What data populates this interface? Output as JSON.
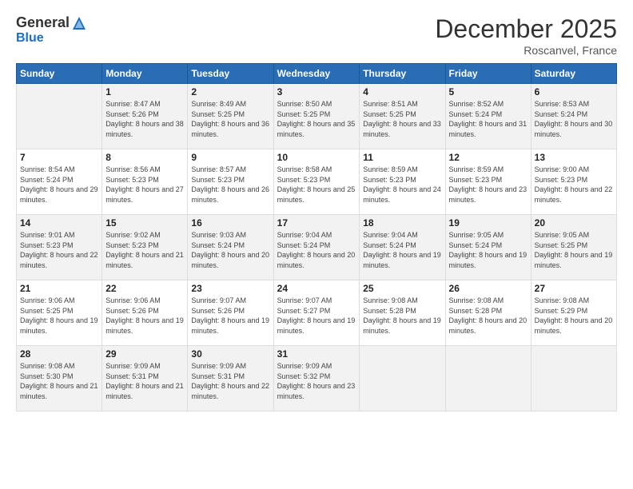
{
  "header": {
    "logo_general": "General",
    "logo_blue": "Blue",
    "month_title": "December 2025",
    "location": "Roscanvel, France"
  },
  "days_of_week": [
    "Sunday",
    "Monday",
    "Tuesday",
    "Wednesday",
    "Thursday",
    "Friday",
    "Saturday"
  ],
  "weeks": [
    [
      {
        "day": "",
        "detail": ""
      },
      {
        "day": "1",
        "detail": "Sunrise: 8:47 AM\nSunset: 5:26 PM\nDaylight: 8 hours\nand 38 minutes."
      },
      {
        "day": "2",
        "detail": "Sunrise: 8:49 AM\nSunset: 5:25 PM\nDaylight: 8 hours\nand 36 minutes."
      },
      {
        "day": "3",
        "detail": "Sunrise: 8:50 AM\nSunset: 5:25 PM\nDaylight: 8 hours\nand 35 minutes."
      },
      {
        "day": "4",
        "detail": "Sunrise: 8:51 AM\nSunset: 5:25 PM\nDaylight: 8 hours\nand 33 minutes."
      },
      {
        "day": "5",
        "detail": "Sunrise: 8:52 AM\nSunset: 5:24 PM\nDaylight: 8 hours\nand 31 minutes."
      },
      {
        "day": "6",
        "detail": "Sunrise: 8:53 AM\nSunset: 5:24 PM\nDaylight: 8 hours\nand 30 minutes."
      }
    ],
    [
      {
        "day": "7",
        "detail": "Sunrise: 8:54 AM\nSunset: 5:24 PM\nDaylight: 8 hours\nand 29 minutes."
      },
      {
        "day": "8",
        "detail": "Sunrise: 8:56 AM\nSunset: 5:23 PM\nDaylight: 8 hours\nand 27 minutes."
      },
      {
        "day": "9",
        "detail": "Sunrise: 8:57 AM\nSunset: 5:23 PM\nDaylight: 8 hours\nand 26 minutes."
      },
      {
        "day": "10",
        "detail": "Sunrise: 8:58 AM\nSunset: 5:23 PM\nDaylight: 8 hours\nand 25 minutes."
      },
      {
        "day": "11",
        "detail": "Sunrise: 8:59 AM\nSunset: 5:23 PM\nDaylight: 8 hours\nand 24 minutes."
      },
      {
        "day": "12",
        "detail": "Sunrise: 8:59 AM\nSunset: 5:23 PM\nDaylight: 8 hours\nand 23 minutes."
      },
      {
        "day": "13",
        "detail": "Sunrise: 9:00 AM\nSunset: 5:23 PM\nDaylight: 8 hours\nand 22 minutes."
      }
    ],
    [
      {
        "day": "14",
        "detail": "Sunrise: 9:01 AM\nSunset: 5:23 PM\nDaylight: 8 hours\nand 22 minutes."
      },
      {
        "day": "15",
        "detail": "Sunrise: 9:02 AM\nSunset: 5:23 PM\nDaylight: 8 hours\nand 21 minutes."
      },
      {
        "day": "16",
        "detail": "Sunrise: 9:03 AM\nSunset: 5:24 PM\nDaylight: 8 hours\nand 20 minutes."
      },
      {
        "day": "17",
        "detail": "Sunrise: 9:04 AM\nSunset: 5:24 PM\nDaylight: 8 hours\nand 20 minutes."
      },
      {
        "day": "18",
        "detail": "Sunrise: 9:04 AM\nSunset: 5:24 PM\nDaylight: 8 hours\nand 19 minutes."
      },
      {
        "day": "19",
        "detail": "Sunrise: 9:05 AM\nSunset: 5:24 PM\nDaylight: 8 hours\nand 19 minutes."
      },
      {
        "day": "20",
        "detail": "Sunrise: 9:05 AM\nSunset: 5:25 PM\nDaylight: 8 hours\nand 19 minutes."
      }
    ],
    [
      {
        "day": "21",
        "detail": "Sunrise: 9:06 AM\nSunset: 5:25 PM\nDaylight: 8 hours\nand 19 minutes."
      },
      {
        "day": "22",
        "detail": "Sunrise: 9:06 AM\nSunset: 5:26 PM\nDaylight: 8 hours\nand 19 minutes."
      },
      {
        "day": "23",
        "detail": "Sunrise: 9:07 AM\nSunset: 5:26 PM\nDaylight: 8 hours\nand 19 minutes."
      },
      {
        "day": "24",
        "detail": "Sunrise: 9:07 AM\nSunset: 5:27 PM\nDaylight: 8 hours\nand 19 minutes."
      },
      {
        "day": "25",
        "detail": "Sunrise: 9:08 AM\nSunset: 5:28 PM\nDaylight: 8 hours\nand 19 minutes."
      },
      {
        "day": "26",
        "detail": "Sunrise: 9:08 AM\nSunset: 5:28 PM\nDaylight: 8 hours\nand 20 minutes."
      },
      {
        "day": "27",
        "detail": "Sunrise: 9:08 AM\nSunset: 5:29 PM\nDaylight: 8 hours\nand 20 minutes."
      }
    ],
    [
      {
        "day": "28",
        "detail": "Sunrise: 9:08 AM\nSunset: 5:30 PM\nDaylight: 8 hours\nand 21 minutes."
      },
      {
        "day": "29",
        "detail": "Sunrise: 9:09 AM\nSunset: 5:31 PM\nDaylight: 8 hours\nand 21 minutes."
      },
      {
        "day": "30",
        "detail": "Sunrise: 9:09 AM\nSunset: 5:31 PM\nDaylight: 8 hours\nand 22 minutes."
      },
      {
        "day": "31",
        "detail": "Sunrise: 9:09 AM\nSunset: 5:32 PM\nDaylight: 8 hours\nand 23 minutes."
      },
      {
        "day": "",
        "detail": ""
      },
      {
        "day": "",
        "detail": ""
      },
      {
        "day": "",
        "detail": ""
      }
    ]
  ]
}
